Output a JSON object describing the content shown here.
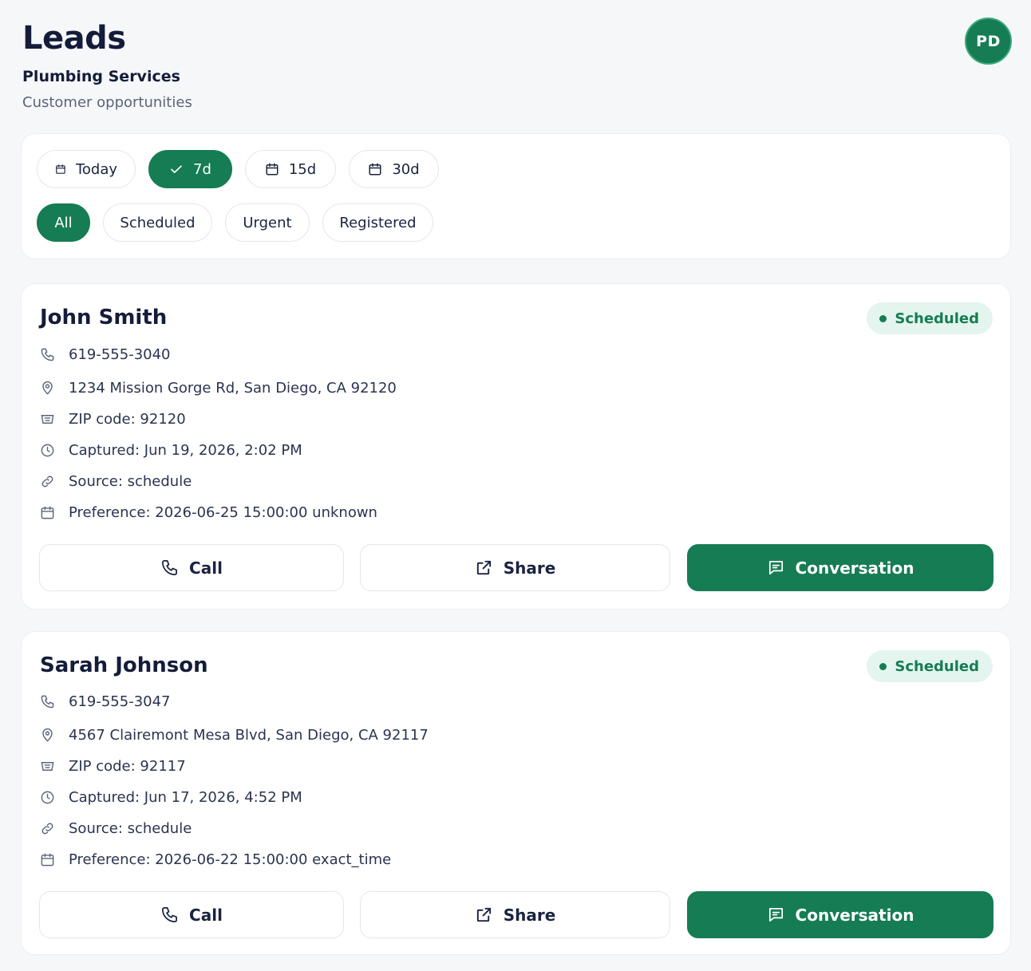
{
  "header": {
    "title": "Leads",
    "subtitle": "Plumbing Services",
    "tagline": "Customer opportunities",
    "avatar_initials": "PD"
  },
  "filters": {
    "periods": [
      {
        "label": "Today",
        "icon": "calendar-icon",
        "active": false
      },
      {
        "label": "7d",
        "icon": "check-icon",
        "active": true
      },
      {
        "label": "15d",
        "icon": "calendar-icon",
        "active": false
      },
      {
        "label": "30d",
        "icon": "calendar-icon",
        "active": false
      }
    ],
    "statuses": [
      {
        "label": "All",
        "active": true
      },
      {
        "label": "Scheduled",
        "active": false
      },
      {
        "label": "Urgent",
        "active": false
      },
      {
        "label": "Registered",
        "active": false
      }
    ]
  },
  "actions": {
    "call_label": "Call",
    "share_label": "Share",
    "conversation_label": "Conversation"
  },
  "leads": [
    {
      "name": "John Smith",
      "status": "Scheduled",
      "phone": "619-555-3040",
      "address": "1234 Mission Gorge Rd, San Diego, CA 92120",
      "zip": "ZIP code: 92120",
      "captured": "Captured: Jun 19, 2026, 2:02 PM",
      "source": "Source: schedule",
      "preference": "Preference: 2026-06-25 15:00:00 unknown"
    },
    {
      "name": "Sarah Johnson",
      "status": "Scheduled",
      "phone": "619-555-3047",
      "address": "4567 Clairemont Mesa Blvd, San Diego, CA 92117",
      "zip": "ZIP code: 92117",
      "captured": "Captured: Jun 17, 2026, 4:52 PM",
      "source": "Source: schedule",
      "preference": "Preference: 2026-06-22 15:00:00 exact_time"
    }
  ],
  "colors": {
    "brand": "#167c54",
    "badge_bg": "#e3f5ee",
    "text_dark": "#141c3a",
    "text_muted": "#5c6478"
  }
}
